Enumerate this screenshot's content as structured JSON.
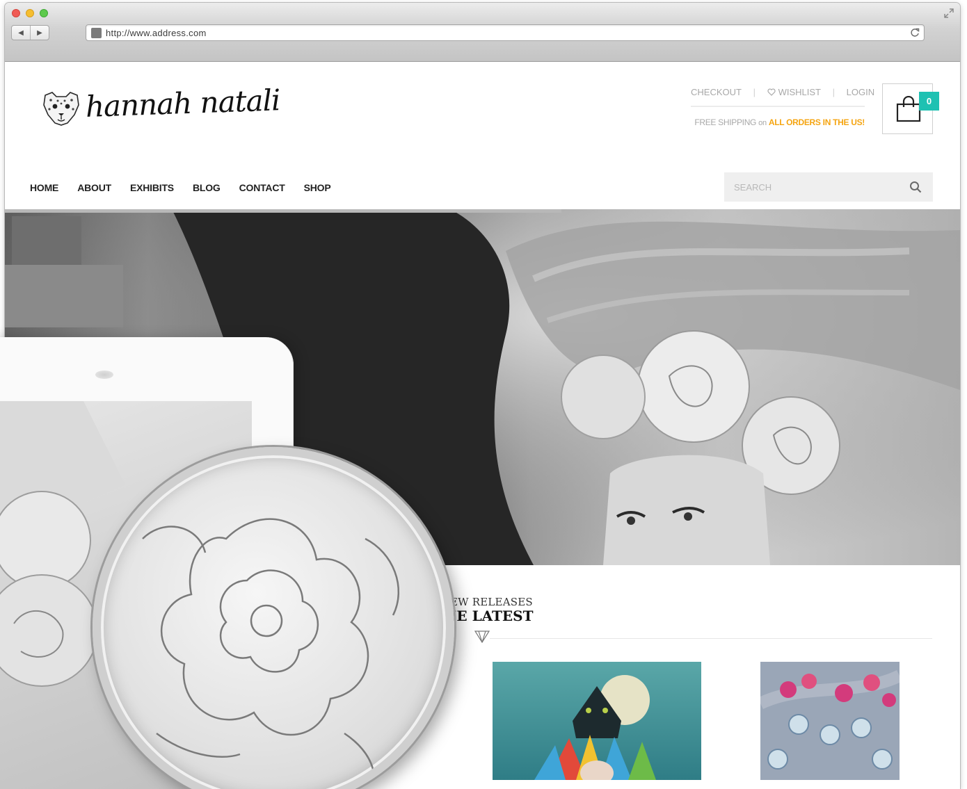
{
  "browser": {
    "url": "http://www.address.com",
    "back_icon": "back-arrow-icon",
    "forward_icon": "forward-arrow-icon",
    "reload_icon": "reload-icon"
  },
  "brand": {
    "name": "hannah natali",
    "logo_icon": "jaguar-head-icon"
  },
  "top_links": {
    "checkout": "CHECKOUT",
    "wishlist": "WISHLIST",
    "login": "LOGIN"
  },
  "shipping": {
    "prefix": "FREE SHIPPING",
    "connector": "on",
    "highlight": "ALL ORDERS IN THE US!"
  },
  "cart": {
    "count": "0",
    "icon": "shopping-bag-icon"
  },
  "nav": [
    "HOME",
    "ABOUT",
    "EXHIBITS",
    "BLOG",
    "CONTACT",
    "SHOP"
  ],
  "search": {
    "placeholder": "SEARCH",
    "icon": "search-icon"
  },
  "new_releases": {
    "kicker": "EW RELEASES",
    "title": "IE LATEST"
  },
  "colors": {
    "accent_teal": "#1ec1b2",
    "highlight_orange": "#f5a512",
    "nav_text": "#222222",
    "muted_text": "#a8a8a8"
  }
}
